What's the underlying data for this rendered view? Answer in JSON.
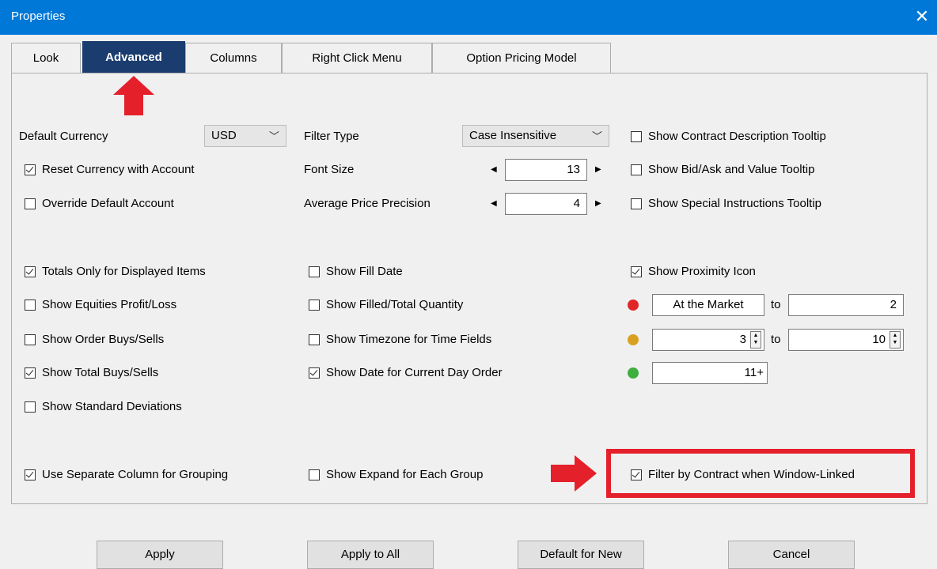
{
  "window": {
    "title": "Properties",
    "close_glyph": "✕"
  },
  "tabs": [
    "Look",
    "Advanced",
    "Columns",
    "Right Click Menu",
    "Option Pricing Model"
  ],
  "active_tab": "Advanced",
  "col1": {
    "default_currency_label": "Default Currency",
    "currency_value": "USD",
    "reset_currency": {
      "label": "Reset Currency with Account",
      "checked": true
    },
    "override_account": {
      "label": "Override Default Account",
      "checked": false
    },
    "totals_only": {
      "label": "Totals Only for Displayed Items",
      "checked": true
    },
    "equities_pl": {
      "label": "Show Equities Profit/Loss",
      "checked": false
    },
    "order_buys_sells": {
      "label": "Show Order Buys/Sells",
      "checked": false
    },
    "total_buys_sells": {
      "label": "Show Total Buys/Sells",
      "checked": true
    },
    "std_dev": {
      "label": "Show Standard Deviations",
      "checked": false
    },
    "separate_column": {
      "label": "Use Separate Column for Grouping",
      "checked": true
    }
  },
  "col2": {
    "filter_type_label": "Filter Type",
    "filter_type_value": "Case Insensitive",
    "font_size_label": "Font Size",
    "font_size_value": "13",
    "avg_price_label": "Average Price Precision",
    "avg_price_value": "4",
    "fill_date": {
      "label": "Show Fill Date",
      "checked": false
    },
    "filled_total": {
      "label": "Show Filled/Total Quantity",
      "checked": false
    },
    "timezone": {
      "label": "Show Timezone for Time Fields",
      "checked": false
    },
    "date_current_day": {
      "label": "Show Date for Current Day Order",
      "checked": true
    },
    "expand_group": {
      "label": "Show Expand for Each Group",
      "checked": false
    }
  },
  "col3": {
    "contract_desc": {
      "label": "Show Contract Description Tooltip",
      "checked": false
    },
    "bid_ask": {
      "label": "Show Bid/Ask and Value Tooltip",
      "checked": false
    },
    "special_instr": {
      "label": "Show Special Instructions Tooltip",
      "checked": false
    },
    "proximity_icon": {
      "label": "Show Proximity Icon",
      "checked": true
    },
    "proximity": {
      "red": {
        "from": "At the Market",
        "to_label": "to",
        "to": "2",
        "color": "#e02626"
      },
      "yellow": {
        "from": "3",
        "to_label": "to",
        "to": "10",
        "color": "#d8a021"
      },
      "green": {
        "from": "11+",
        "color": "#3fae3f"
      }
    },
    "filter_contract": {
      "label": "Filter by Contract when Window-Linked",
      "checked": true
    }
  },
  "buttons": {
    "apply": "Apply",
    "apply_all": "Apply to All",
    "default_new": "Default for New",
    "cancel": "Cancel"
  },
  "annotations": {
    "arrow_color": "#e4202a",
    "highlight_color": "#e4202a"
  }
}
